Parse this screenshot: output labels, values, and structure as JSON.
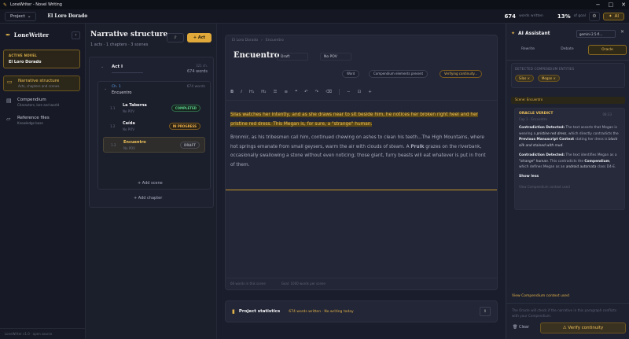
{
  "window": {
    "title": "LoneWriter - Novel Writing"
  },
  "topbar": {
    "project_label": "Project",
    "book_title": "El Loro Dorado",
    "words_count": "674",
    "words_label": "words written",
    "goal_pct": "13%",
    "goal_label": "of goal",
    "ai_label": "AI"
  },
  "sidebar": {
    "brand": "LoneWriter",
    "active_novel_label": "ACTIVE NOVEL",
    "active_novel_value": "El Loro Dorado",
    "items": [
      {
        "label": "Narrative structure",
        "sub": "Acts, chapters and scenes"
      },
      {
        "label": "Compendium",
        "sub": "Characters, lore and world"
      },
      {
        "label": "Reference files",
        "sub": "Knowledge base"
      }
    ],
    "footer": "LoneWriter v1.0 · open source"
  },
  "structure": {
    "title": "Narrative structure",
    "subtitle": "1 acts · 1 chapters · 3 scenes",
    "add_act": "+ Act",
    "act": {
      "name": "Act I",
      "chars": "321 ch.",
      "words": "674 words"
    },
    "chapter": {
      "label": "Ch. 1",
      "name": "Encuentro",
      "words": "674 words"
    },
    "scenes": [
      {
        "num": "1.1",
        "name": "La Taberna",
        "pov": "No POV",
        "status": "COMPLETED"
      },
      {
        "num": "1.2",
        "name": "Caída",
        "pov": "No POV",
        "status": "IN PROGRESS"
      },
      {
        "num": "1.3",
        "name": "Encuentro",
        "pov": "No POV",
        "status": "DRAFT"
      }
    ],
    "add_scene": "+ Add scene",
    "add_chapter": "+ Add chapter"
  },
  "editor": {
    "crumbs": [
      "El Loro Dorado",
      "›",
      "Encuentro"
    ],
    "scene_title": "Encuentro",
    "status": "Draft",
    "pov": "No POV",
    "pills": {
      "word": "Word",
      "compendium": "Compendium elements present",
      "verifying": "Verifying continuity..."
    },
    "highlighted": "Silas watches her intently, and as she draws near to sit beside him, he notices her broken right heel and her pristine red dress. This Megan is, for sure, a \"strange\" human.",
    "paragraph_a": "Bronmir, as his tribesmen call him, continued chewing on ashes to clean his teeth...The High Mountains, where hot springs emanate from small geysers, warm the air with clouds of steam. A ",
    "paragraph_bold": "Prulk",
    "paragraph_b": " grazes on the riverbank, occasionally swallowing a stone without even noticing; those giant, furry beasts will eat whatever is put in front of them.",
    "footer_left": "66 words in this scene",
    "footer_right": "Goal: 1000 words per scene"
  },
  "stats": {
    "title": "Project statistics",
    "summary": "674 words written · No writing today"
  },
  "ai": {
    "title": "AI Assistant",
    "model": "gemini-2.5-fl...",
    "tabs": [
      "Rewrite",
      "Debate",
      "Oracle"
    ],
    "detected_label": "DETECTED COMPENDIUM ENTITIES",
    "entities": [
      "Silas",
      "Megan"
    ],
    "scene_chip": "Scene: Encuentro",
    "verdict": {
      "title": "ORACLE VERDICT",
      "time": "08:33",
      "sub": "Cap 1 · Encuentro",
      "p1_head": "Contradiction Detected:",
      "p1_a": " The text asserts that Megan is wearing a ",
      "p1_i": "pristine red dress",
      "p1_b": ", which directly contradicts the ",
      "p1_b2": "Previous Manuscript Context",
      "p1_c": " stating her dress is ",
      "p1_i2": "black silk and stained with mud",
      "p1_d": ".",
      "p2_head": "Contradiction Detected:",
      "p2_a": " The text identifies Megan as a ",
      "p2_i": "\"strange\" human",
      "p2_b": ". This contradicts the ",
      "p2_b2": "Compendium",
      "p2_c": ", which defines Megan as an ",
      "p2_i2": "android automata",
      "p2_d": " class D4-E.",
      "show": "Show less",
      "ctx": "View Compendium context used"
    },
    "view_ctx": "View Compendium context used",
    "hint": "The Oracle will check if the narrative in this paragraph conflicts with your Compendium.",
    "clear": "Clear",
    "verify": "Verify continuity"
  }
}
